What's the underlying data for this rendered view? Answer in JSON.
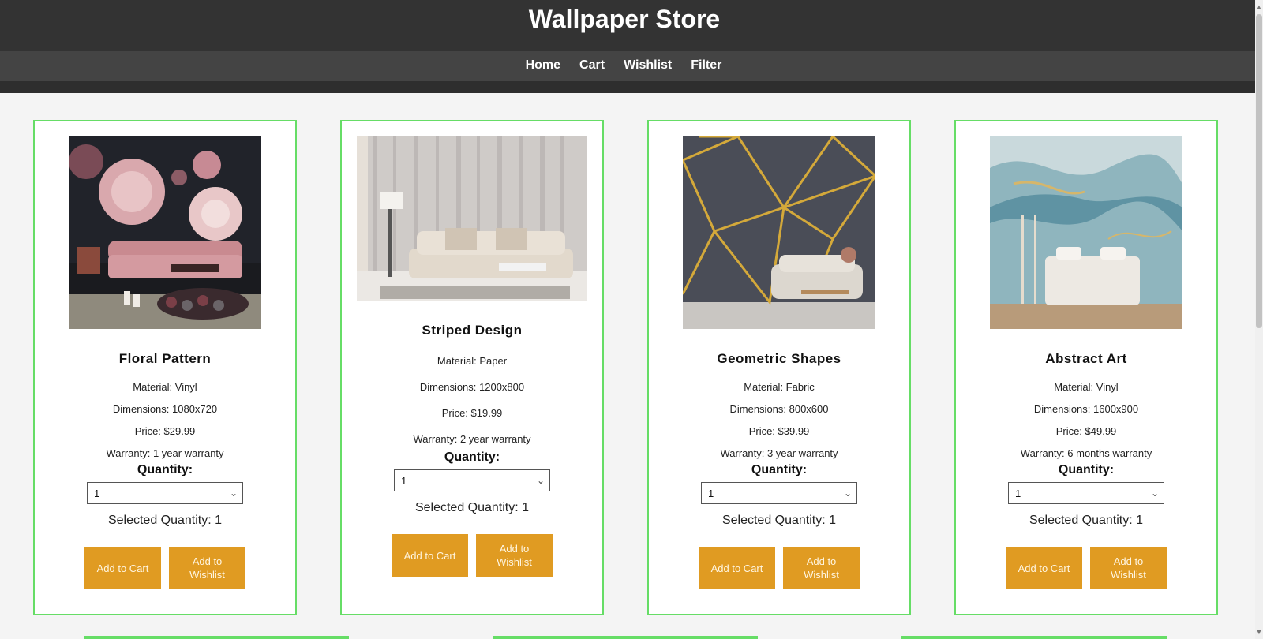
{
  "header": {
    "title": "Wallpaper Store"
  },
  "nav": {
    "items": [
      "Home",
      "Cart",
      "Wishlist",
      "Filter"
    ]
  },
  "labels": {
    "quantity": "Quantity:",
    "add_to_cart": "Add to Cart",
    "add_to_wishlist": "Add to Wishlist"
  },
  "products": [
    {
      "name": "Floral Pattern",
      "material": "Material: Vinyl",
      "dimensions": "Dimensions: 1080x720",
      "price": "Price: $29.99",
      "warranty": "Warranty: 1 year warranty",
      "quantity_value": "1",
      "selected_quantity": "Selected Quantity: 1"
    },
    {
      "name": "Striped Design",
      "material": "Material: Paper",
      "dimensions": "Dimensions: 1200x800",
      "price": "Price: $19.99",
      "warranty": "Warranty: 2 year warranty",
      "quantity_value": "1",
      "selected_quantity": "Selected Quantity: 1"
    },
    {
      "name": "Geometric Shapes",
      "material": "Material: Fabric",
      "dimensions": "Dimensions: 800x600",
      "price": "Price: $39.99",
      "warranty": "Warranty: 3 year warranty",
      "quantity_value": "1",
      "selected_quantity": "Selected Quantity: 1"
    },
    {
      "name": "Abstract Art",
      "material": "Material: Vinyl",
      "dimensions": "Dimensions: 1600x900",
      "price": "Price: $49.99",
      "warranty": "Warranty: 6 months warranty",
      "quantity_value": "1",
      "selected_quantity": "Selected Quantity: 1"
    }
  ],
  "colors": {
    "header_bg": "#333333",
    "nav_bg": "#444444",
    "card_border": "#66dd66",
    "button_bg": "#e09b22"
  },
  "icons": {
    "select_chevron": "chevron-down-icon",
    "scroll_up": "scroll-up-arrow-icon",
    "scroll_down": "scroll-down-arrow-icon"
  }
}
